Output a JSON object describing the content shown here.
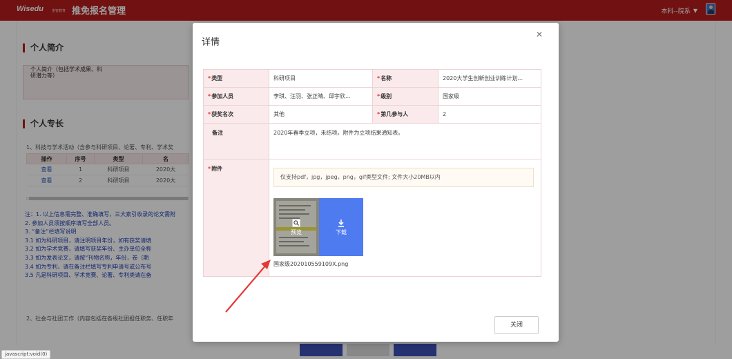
{
  "header": {
    "logo": "Wisedu",
    "logo_sub": "金智教育",
    "app_title": "推免报名管理",
    "user": "本科--院系"
  },
  "background": {
    "sections": [
      {
        "title": "个人简介"
      },
      {
        "title": "个人专长"
      }
    ],
    "intro_label": "个人简介（包括学术成果、科研潜力等）",
    "paragraph_1": "1、科技与学术活动（含参与科研项目、论著、专利、学术奖",
    "table": {
      "headers": [
        "操作",
        "序号",
        "类型",
        "名"
      ],
      "rows": [
        [
          "查看",
          "1",
          "科研项目",
          "2020大"
        ],
        [
          "查看",
          "2",
          "科研项目",
          "2020大"
        ]
      ]
    },
    "notes": [
      "注：1. 以上信息需完整、准确填写，三大索引收录的论文需附",
      "    2. 参加人员须按顺序填写全部人员。",
      "    3. “备注”栏填写说明",
      "        3.1 如为科研项目，请注明项目年份，如有获奖请填",
      "        3.2 如为学术竞赛，请填写获奖年份、主办单位全称",
      "        3.3 如为发表论文，请按“刊物名称，年份，卷（期",
      "        3.4 如为专利，请在备注栏填写专利申请号或公布号",
      "        3.5 凡是科研项目、学术竞赛、论著、专利类请在备"
    ],
    "paragraph_2": "2、社会与社团工作（内容包括在各级社团担任职务、任职年"
  },
  "modal": {
    "title": "详情",
    "close_icon": "close-icon",
    "fields": {
      "type_label": "类型",
      "type_value": "科研项目",
      "name_label": "名称",
      "name_value": "2020大学生创新创业训练计划...",
      "members_label": "参加人员",
      "members_value": "李琪、汪羽、张正晴、邱宇欣...",
      "level_label": "级别",
      "level_value": "国家级",
      "award_label": "获奖名次",
      "award_value": "其他",
      "rank_label": "第几参与人",
      "rank_value": "2",
      "remark_label": "备注",
      "remark_value": "2020年春季立项，未结项。附件为立项结果通知表。",
      "attach_label": "附件",
      "upload_hint": "仅支持pdf，jpg，jpeg，png，gif类型文件; 文件大小20MB以内",
      "preview_label": "预览",
      "download_label": "下载",
      "file_name": "国家级202010559109X.png"
    },
    "close_button": "关闭"
  },
  "status_bar": "javascript:void(0)",
  "colors": {
    "brand_red": "#b71c1c",
    "label_bg": "#fbeaeb",
    "download_blue": "#4f7bf0",
    "arrow_red": "#e53935",
    "notes_blue": "#1f3fb5"
  }
}
